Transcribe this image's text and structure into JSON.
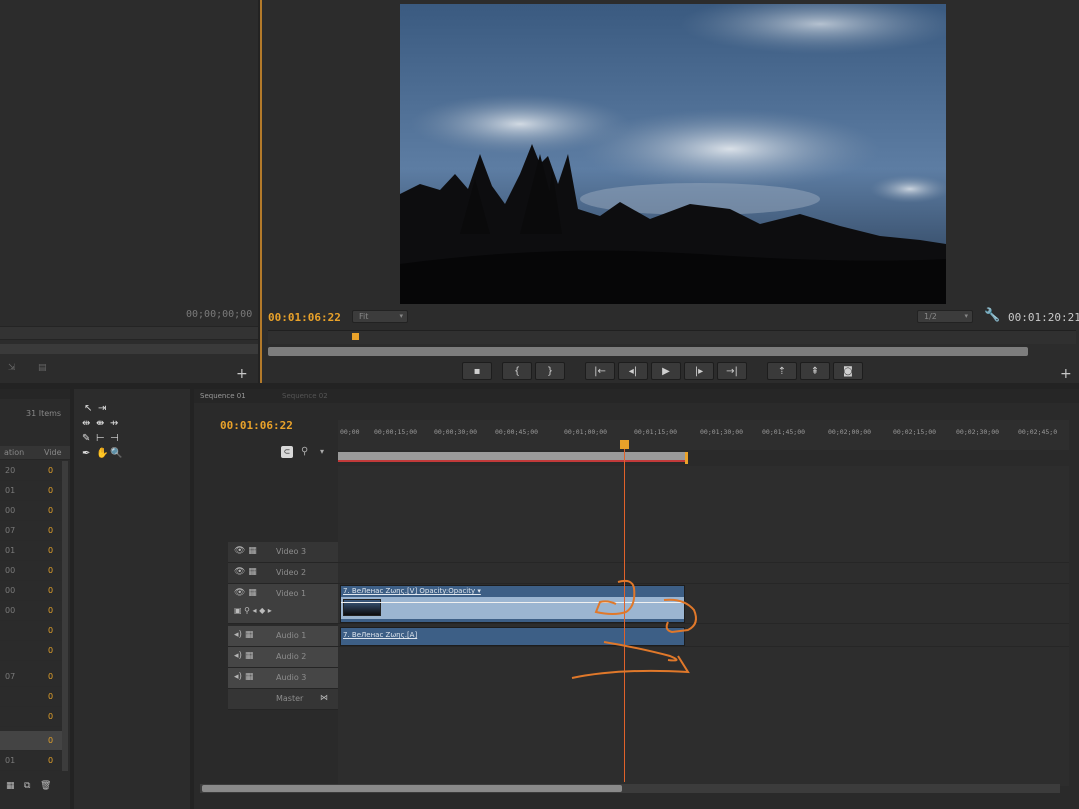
{
  "source_monitor": {
    "timecode": "00;00;00;00"
  },
  "program_monitor": {
    "current_time": "00:01:06:22",
    "duration": "00:01:20:21",
    "zoom_select": "Fit",
    "quality_select": "1/2"
  },
  "project_panel": {
    "item_count": "31 Items",
    "columns": [
      "ation",
      "Vide"
    ],
    "rows": [
      {
        "a": "20",
        "b": "0"
      },
      {
        "a": "01",
        "b": "0"
      },
      {
        "a": "00",
        "b": "0"
      },
      {
        "a": "07",
        "b": "0"
      },
      {
        "a": "01",
        "b": "0"
      },
      {
        "a": "00",
        "b": "0"
      },
      {
        "a": "00",
        "b": "0"
      },
      {
        "a": "00",
        "b": "0"
      },
      {
        "a": "",
        "b": "0"
      },
      {
        "a": "",
        "b": "0"
      },
      {
        "a": "07",
        "b": "0"
      },
      {
        "a": "",
        "b": "0"
      },
      {
        "a": "",
        "b": "0"
      },
      {
        "a": "",
        "b": "0"
      },
      {
        "a": "",
        "b": "0"
      },
      {
        "a": "01",
        "b": "0"
      }
    ]
  },
  "timeline": {
    "tabs": [
      "Sequence 01",
      "Sequence 02"
    ],
    "current_time": "00:01:06:22",
    "ruler_labels": [
      "00;00",
      "00;00;15;00",
      "00;00;30;00",
      "00;00;45;00",
      "00;01;00;00",
      "00;01;15;00",
      "00;01;30;00",
      "00;01;45;00",
      "00;02;00;00",
      "00;02;15;00",
      "00;02;30;00",
      "00;02;45;0"
    ],
    "tracks": {
      "video3": "Video 3",
      "video2": "Video 2",
      "video1": "Video 1",
      "audio1": "Audio 1",
      "audio2": "Audio 2",
      "audio3": "Audio 3",
      "master": "Master"
    },
    "video_clip_label": "7. ВеЛенас Ζωης.[V]  Opacity:Opacity ▾",
    "audio_clip_label": "7. ВеЛенас Ζωης.[A]"
  },
  "colors": {
    "accent": "#e9a22a",
    "playhead": "#e0622a",
    "clip_video": "#9bb5d1",
    "clip_audio": "#3d5f86",
    "annotation": "#e0782a"
  }
}
